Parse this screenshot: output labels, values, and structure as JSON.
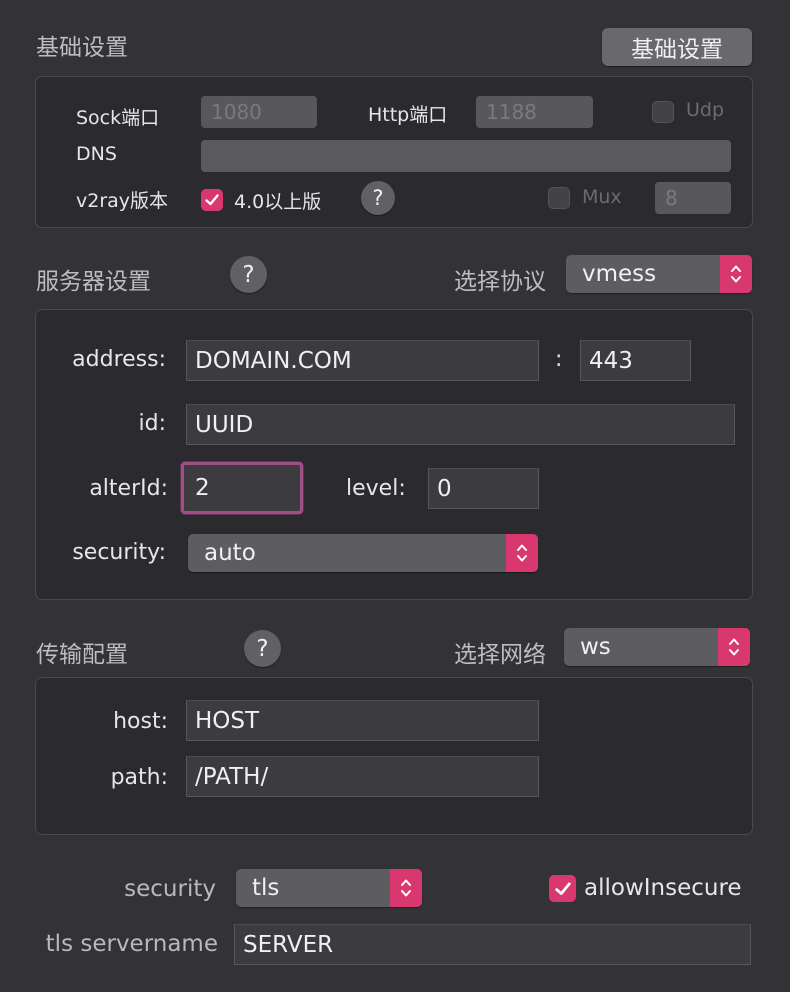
{
  "basic": {
    "title": "基础设置",
    "button": "基础设置",
    "sock_label": "Sock端口",
    "sock_value": "1080",
    "http_label": "Http端口",
    "http_value": "1188",
    "udp_label": "Udp",
    "dns_label": "DNS",
    "dns_value": "",
    "v2ray_label": "v2ray版本",
    "v2ray_check_label": "4.0以上版",
    "help": "?",
    "mux_label": "Mux",
    "mux_value": "8"
  },
  "server": {
    "title": "服务器设置",
    "help": "?",
    "protocol_label": "选择协议",
    "protocol_value": "vmess",
    "address_label": "address:",
    "address_value": "DOMAIN.COM",
    "colon": ":",
    "port_value": "443",
    "id_label": "id:",
    "id_value": "UUID",
    "alterid_label": "alterId:",
    "alterid_value": "2",
    "level_label": "level:",
    "level_value": "0",
    "security_label": "security:",
    "security_value": "auto"
  },
  "transport": {
    "title": "传输配置",
    "help": "?",
    "network_label": "选择网络",
    "network_value": "ws",
    "host_label": "host:",
    "host_value": "HOST",
    "path_label": "path:",
    "path_value": "/PATH/"
  },
  "tls": {
    "security_label": "security",
    "security_value": "tls",
    "allow_insecure_label": "allowInsecure",
    "servername_label": "tls servername",
    "servername_value": "SERVER"
  },
  "colors": {
    "accent": "#d9386f",
    "focus": "#a24f87",
    "background": "#333236"
  }
}
